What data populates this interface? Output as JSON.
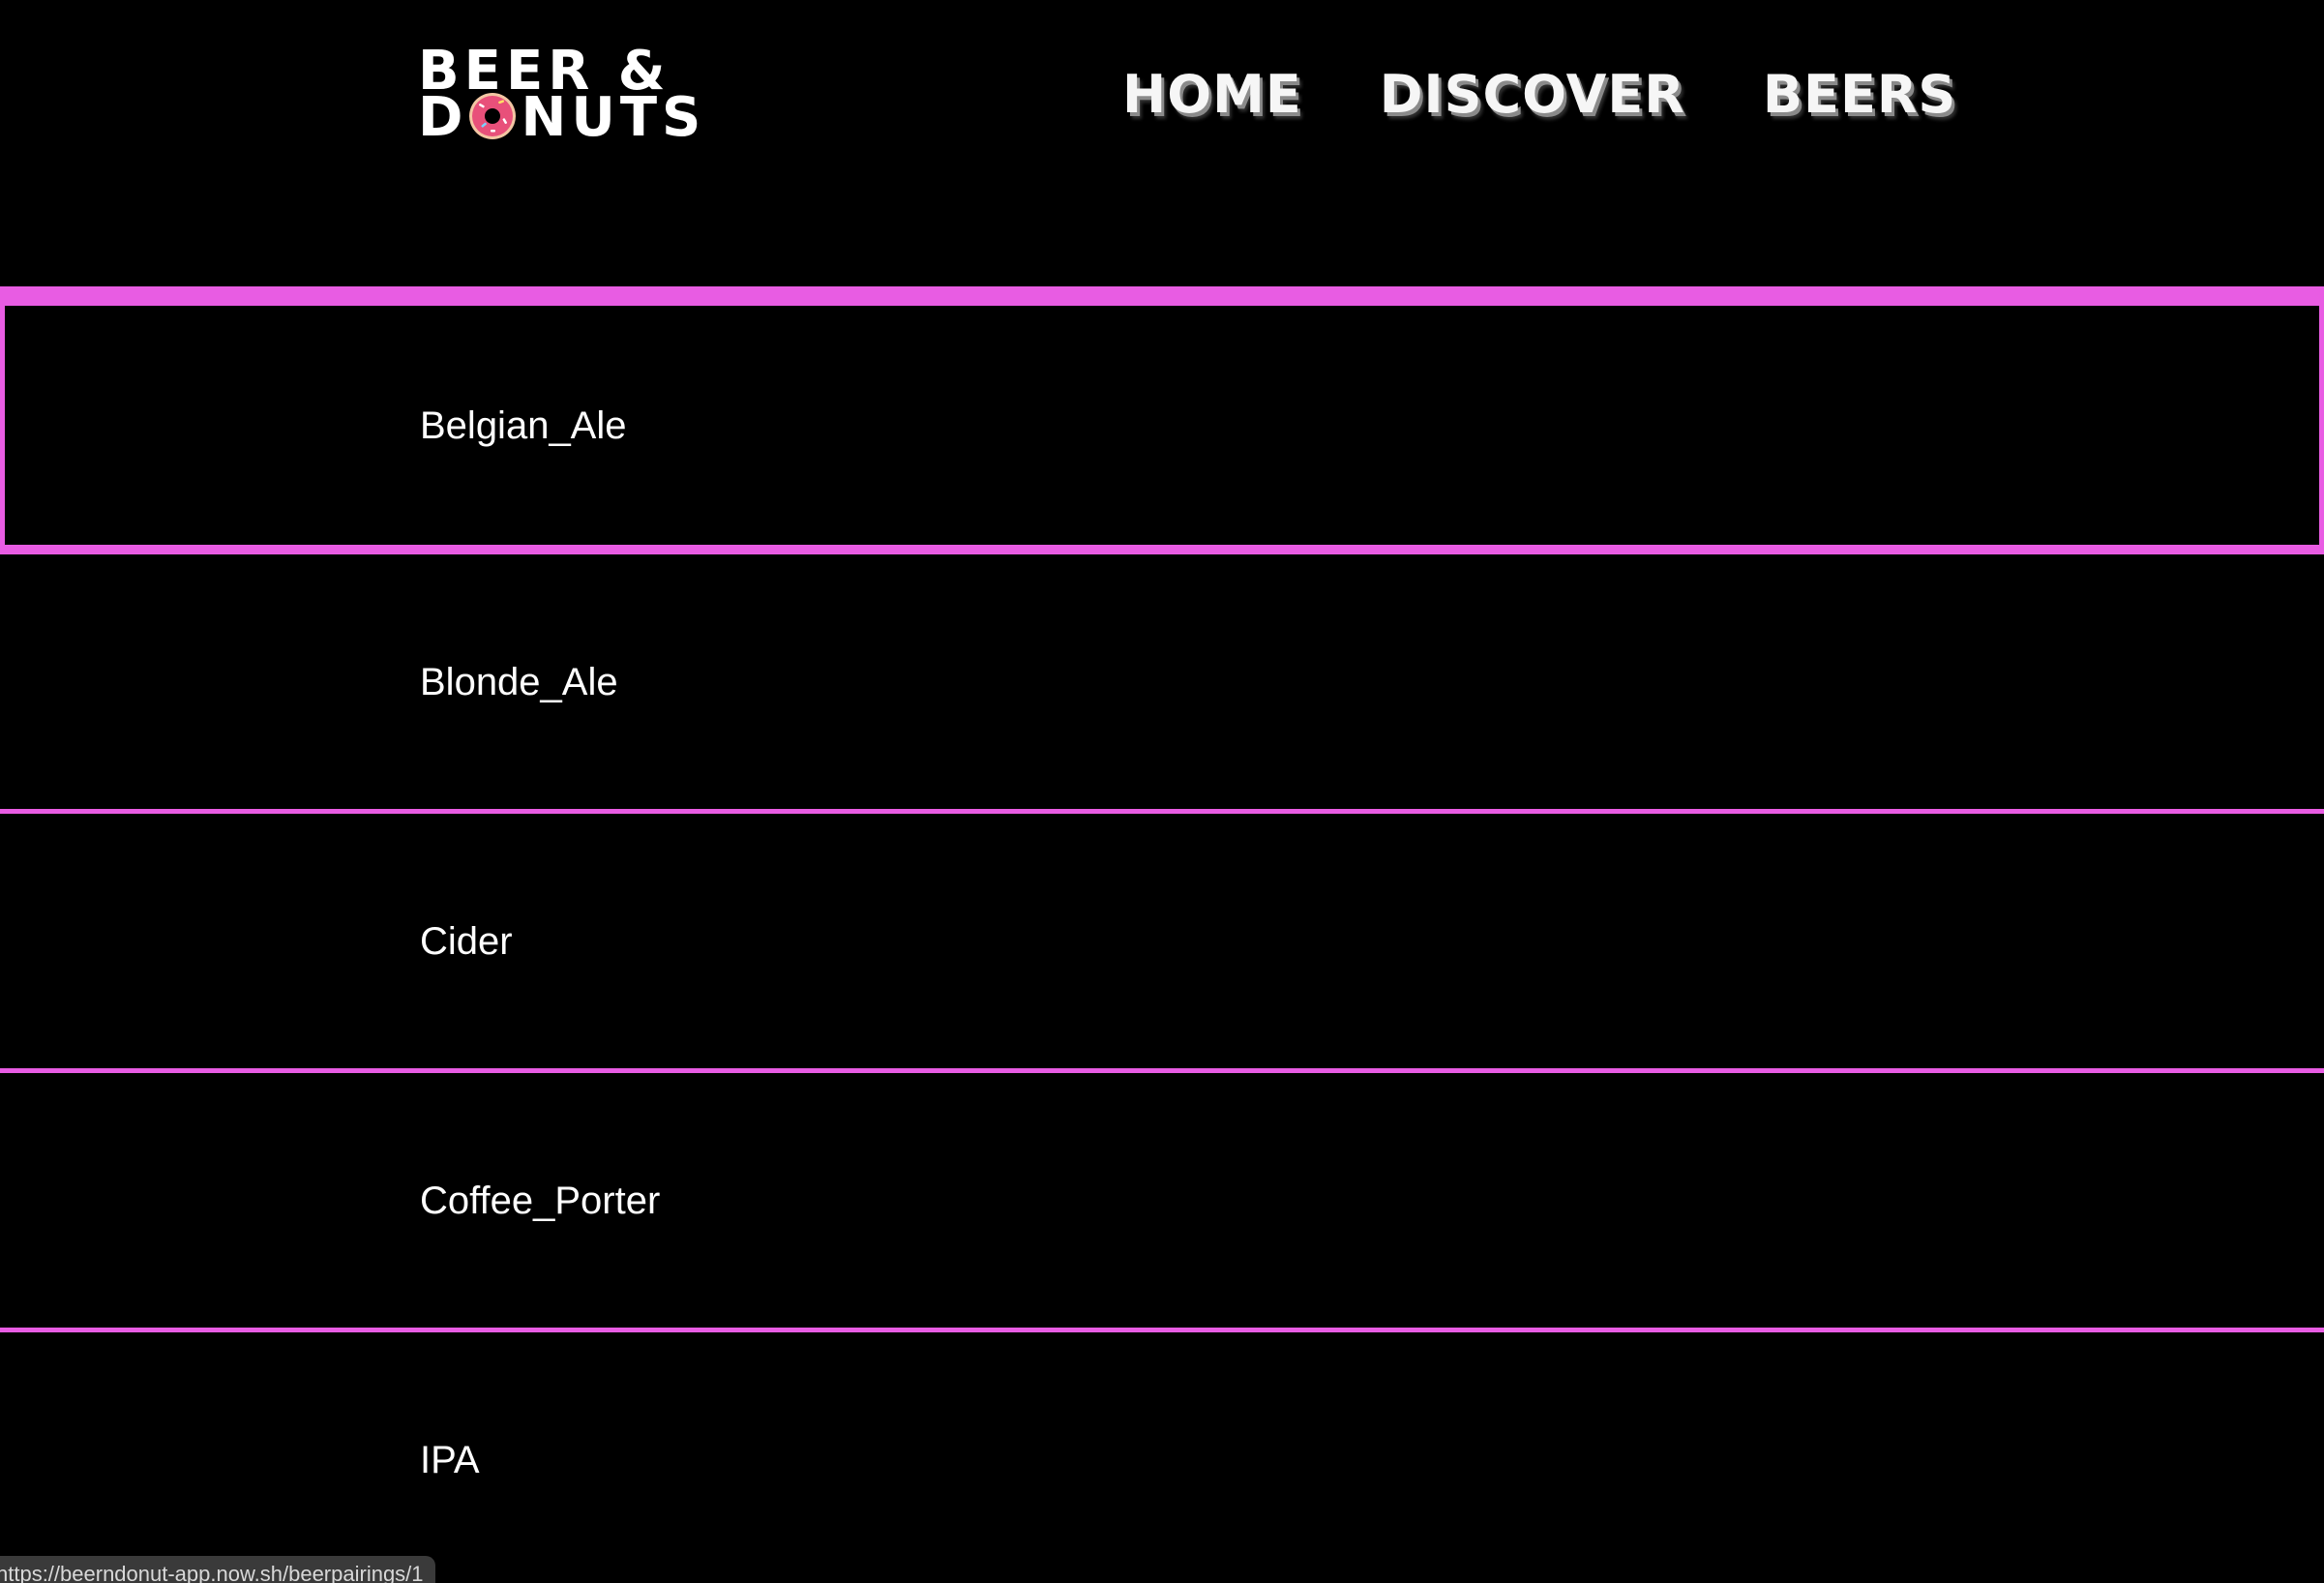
{
  "brand": {
    "logo_line1": "BEER &",
    "logo_line2_first": "D",
    "logo_line2_rest": "NUTS",
    "donut_color": "#e8507a",
    "donut_icon": "donut-icon"
  },
  "nav": {
    "items": [
      {
        "label": "HOME"
      },
      {
        "label": "DISCOVER"
      },
      {
        "label": "BEERS"
      }
    ]
  },
  "list": {
    "accent_color": "#e85ce3",
    "items": [
      {
        "label": "Belgian_Ale",
        "active": true
      },
      {
        "label": "Blonde_Ale",
        "active": false
      },
      {
        "label": "Cider",
        "active": false
      },
      {
        "label": "Coffee_Porter",
        "active": false
      },
      {
        "label": "IPA",
        "active": false
      }
    ]
  },
  "status_bar": {
    "url": "https://beerndonut-app.now.sh/beerpairings/1"
  }
}
